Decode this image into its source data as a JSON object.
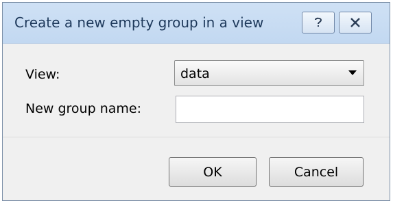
{
  "dialog": {
    "title": "Create a new empty group in a view",
    "help_button_icon": "help-icon",
    "close_button_icon": "close-icon"
  },
  "form": {
    "view_label": "View:",
    "view_value": "data",
    "group_name_label": "New group name:",
    "group_name_value": ""
  },
  "buttons": {
    "ok_label": "OK",
    "cancel_label": "Cancel"
  }
}
